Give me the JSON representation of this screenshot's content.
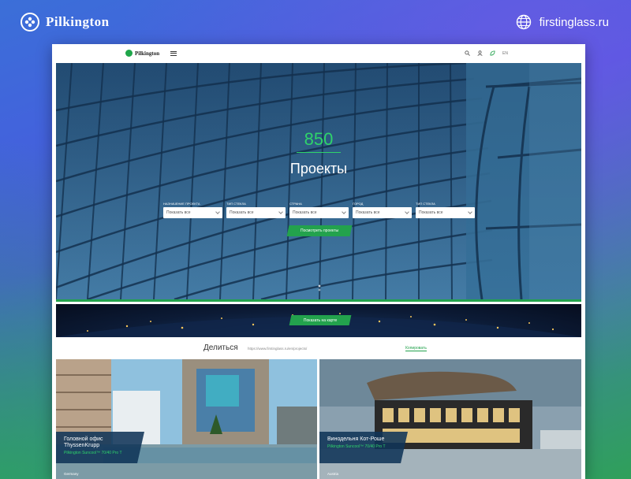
{
  "header": {
    "brand": "Pilkington",
    "site": "firstinglass.ru"
  },
  "nav": {
    "logo": "Pilkington",
    "lang": "EN"
  },
  "hero": {
    "count": "850",
    "title": "Проекты",
    "filters": [
      {
        "label": "Назначение проекта",
        "value": "Показать все"
      },
      {
        "label": "Тип стекла",
        "value": "Показать все"
      },
      {
        "label": "Страна",
        "value": "Показать все"
      },
      {
        "label": "Город",
        "value": "Показать все"
      },
      {
        "label": "Тип стекла",
        "value": "Показать все"
      }
    ],
    "submit": "Посмотреть проекты"
  },
  "map": {
    "button": "Показать на карте"
  },
  "share": {
    "title": "Делиться",
    "url": "https://www.firstinglass.ru/en/projects/",
    "copy": "Копировать"
  },
  "cards": [
    {
      "title": "Головной офис ThyssenKrupp",
      "product": "Pilkington Suncool™ 70/40 Pro T",
      "country": "Germany"
    },
    {
      "title": "Винодельня Кот-Роше",
      "product": "Pilkington Suncool™ 70/40 Pro T",
      "country": "Austria"
    }
  ],
  "colors": {
    "accent": "#23a24d",
    "hero_count": "#2fd36a",
    "caption_bg": "#103458"
  }
}
